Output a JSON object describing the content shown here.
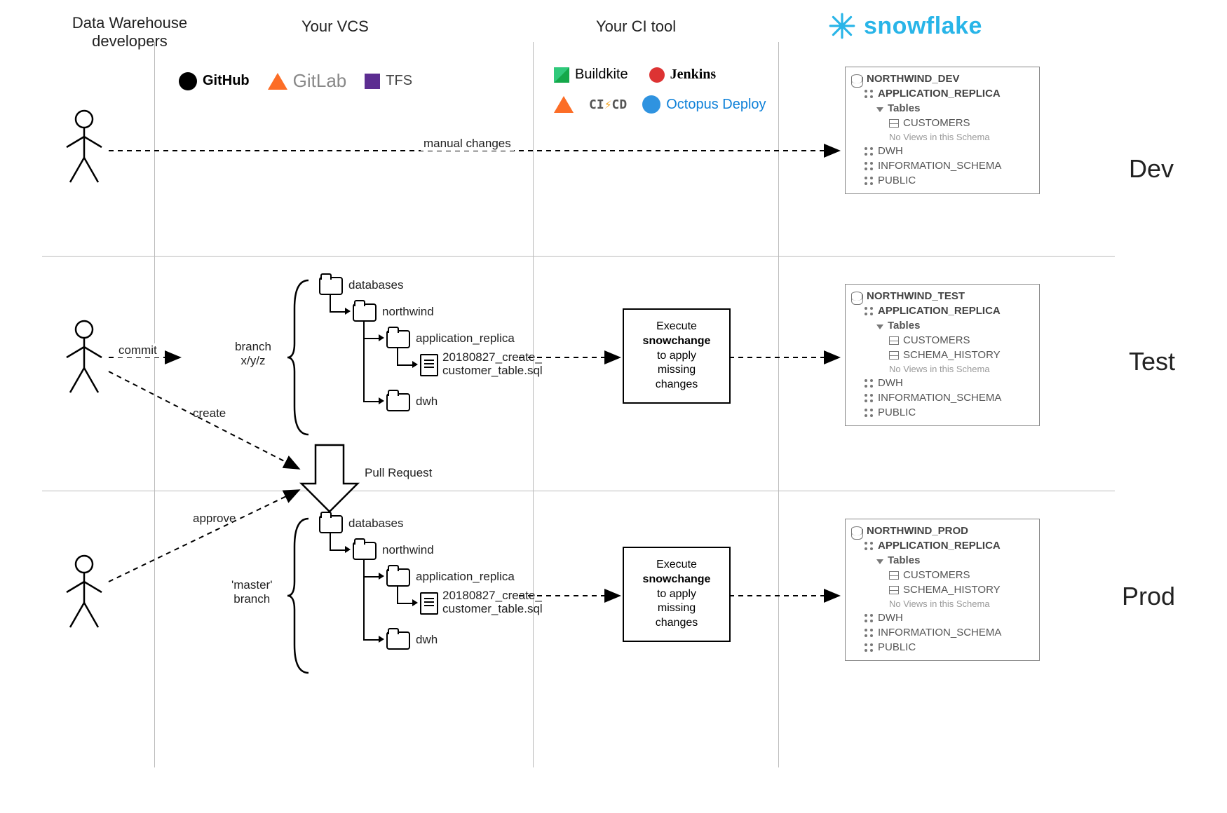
{
  "columns": {
    "devs": "Data Warehouse\ndevelopers",
    "vcs": "Your VCS",
    "ci": "Your CI tool",
    "platform": "snowflake"
  },
  "logos": {
    "vcs": [
      {
        "name": "github",
        "label": "GitHub"
      },
      {
        "name": "gitlab",
        "label": "GitLab"
      },
      {
        "name": "tfs",
        "label": "TFS"
      }
    ],
    "ci": [
      {
        "name": "buildkite",
        "label": "Buildkite"
      },
      {
        "name": "jenkins",
        "label": "Jenkins"
      },
      {
        "name": "gitlab-ci",
        "label": ""
      },
      {
        "name": "cico",
        "label": "CI/CD"
      },
      {
        "name": "octopus",
        "label": "Octopus Deploy"
      }
    ]
  },
  "envs": {
    "dev": "Dev",
    "test": "Test",
    "prod": "Prod"
  },
  "arrows": {
    "manual_changes": "manual changes",
    "commit": "commit",
    "create": "create",
    "approve": "approve",
    "branch_xyz": "branch\nx/y/z",
    "master_branch": "'master'\nbranch",
    "pull_request": "Pull Request"
  },
  "tree": {
    "databases": "databases",
    "northwind": "northwind",
    "app_replica": "application_replica",
    "sqlfile": "20180827_create_\ncustomer_table.sql",
    "dwh": "dwh"
  },
  "exec": {
    "l1": "Execute",
    "l2": "snowchange",
    "l3": "to apply",
    "l4": "missing",
    "l5": "changes"
  },
  "db": {
    "dev": {
      "name": "NORTHWIND_DEV",
      "schema": "APPLICATION_REPLICA",
      "tables_label": "Tables",
      "tables": [
        "CUSTOMERS"
      ],
      "no_views": "No Views in this Schema",
      "others": [
        "DWH",
        "INFORMATION_SCHEMA",
        "PUBLIC"
      ]
    },
    "test": {
      "name": "NORTHWIND_TEST",
      "schema": "APPLICATION_REPLICA",
      "tables_label": "Tables",
      "tables": [
        "CUSTOMERS",
        "SCHEMA_HISTORY"
      ],
      "no_views": "No Views in this Schema",
      "others": [
        "DWH",
        "INFORMATION_SCHEMA",
        "PUBLIC"
      ]
    },
    "prod": {
      "name": "NORTHWIND_PROD",
      "schema": "APPLICATION_REPLICA",
      "tables_label": "Tables",
      "tables": [
        "CUSTOMERS",
        "SCHEMA_HISTORY"
      ],
      "no_views": "No Views in this Schema",
      "others": [
        "DWH",
        "INFORMATION_SCHEMA",
        "PUBLIC"
      ]
    }
  }
}
